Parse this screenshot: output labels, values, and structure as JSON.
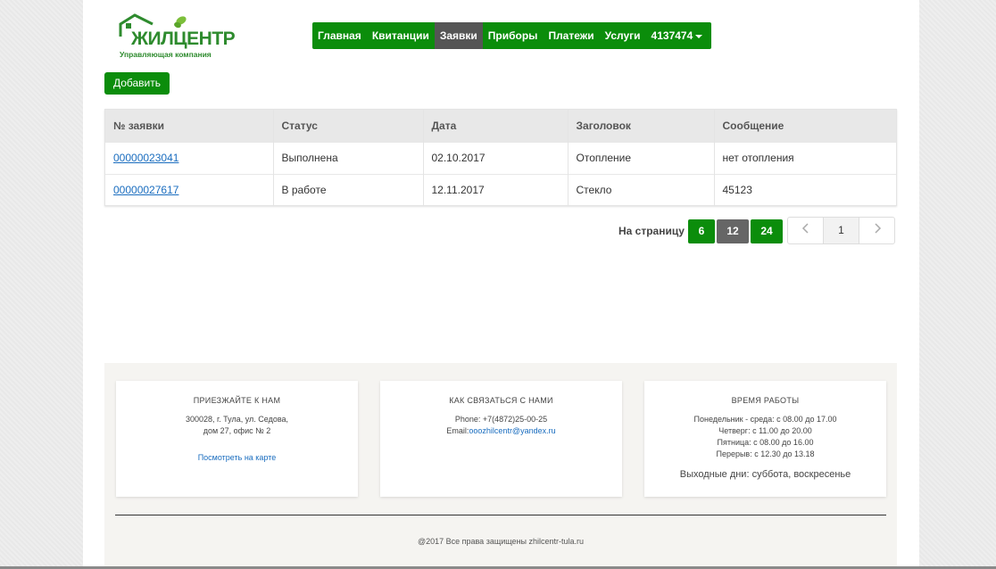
{
  "brand": {
    "logo_text": "ЖИЛЦЕНТР",
    "logo_subtitle": "Управляющая компания",
    "color": "#2e8b2e"
  },
  "nav": {
    "items": [
      {
        "label": "Главная"
      },
      {
        "label": "Квитанции"
      },
      {
        "label": "Заявки",
        "active": true
      },
      {
        "label": "Приборы"
      },
      {
        "label": "Платежи"
      },
      {
        "label": "Услуги"
      },
      {
        "label": "4137474"
      }
    ],
    "accent": "#0b8d0b",
    "active_color": "#555555"
  },
  "add_button": {
    "label": "Добавить"
  },
  "requests_table": {
    "headers": [
      "№ заявки",
      "Статус",
      "Дата",
      "Заголовок",
      "Сообщение"
    ],
    "rows": [
      {
        "number": "00000023041",
        "status": "Выполнена",
        "date": "02.10.2017",
        "title": "Отопление",
        "message": "нет отопления"
      },
      {
        "number": "00000027617",
        "status": "В работе",
        "date": "12.11.2017",
        "title": "Стекло",
        "message": "45123"
      }
    ]
  },
  "per_page": {
    "label": "На страницу",
    "options": [
      "6",
      "12",
      "24"
    ],
    "selected": "12"
  },
  "pagination": {
    "current_page": "1",
    "prev_icon": "chevron-left-icon",
    "next_icon": "chevron-right-icon"
  },
  "footer": {
    "visit": {
      "title": "ПРИЕЗЖАЙТЕ К НАМ",
      "address_line1": "300028, г. Тула, ул. Седова,",
      "address_line2": "дом 27, офис № 2",
      "map_link": "Посмотреть на карте"
    },
    "contact": {
      "title": "КАК СВЯЗАТЬСЯ С НАМИ",
      "phone": "Phone: +7(4872)25-00-25",
      "email_label": "Email:",
      "email": "ooozhilcentr@yandex.ru"
    },
    "hours": {
      "title": "ВРЕМЯ РАБОТЫ",
      "lines": [
        "Понедельник - среда: с 08.00 до 17.00",
        "Четверг: с 11.00 до 20.00",
        "Пятница: с 08.00 до 16.00",
        "Перерыв: с 12.30 до 13.18"
      ],
      "weekend": "Выходные дни: суббота, воскресенье"
    },
    "copyright": "@2017 Все права защищены zhilcentr-tula.ru"
  }
}
